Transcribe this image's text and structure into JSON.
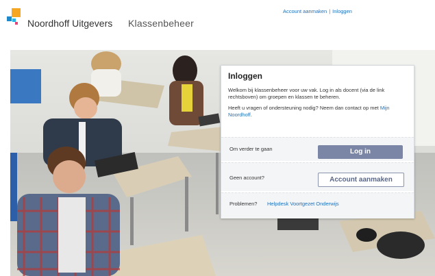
{
  "header": {
    "brand": "Noordhoff Uitgevers",
    "app_name": "Klassenbeheer",
    "links": {
      "create_account": "Account aanmaken",
      "separator": "|",
      "login": "Inloggen"
    }
  },
  "login_panel": {
    "title": "Inloggen",
    "intro": "Welkom bij klassenbeheer voor uw vak. Log in als docent (via de link rechtsboven) om groepen en klassen te beheren.",
    "help_text": "Heeft u vragen of ondersteuning nodig? Neem dan contact op met",
    "help_link": "Mijn Noordhoff",
    "help_suffix": ".",
    "continue_label": "Om verder te gaan",
    "login_button": "Log in",
    "no_account_label": "Geen account?",
    "create_account_button": "Account aanmaken",
    "problems_label": "Problemen?",
    "helpdesk_link": "Helpdesk Voortgezet Onderwijs"
  },
  "colors": {
    "link": "#1f6fb8",
    "primary_button": "#7b86a6",
    "logo_orange": "#f5a623",
    "logo_blue": "#1e88c8",
    "logo_pink": "#e0457b"
  },
  "hero": {
    "alt_subject": "students-in-classroom-photo"
  }
}
